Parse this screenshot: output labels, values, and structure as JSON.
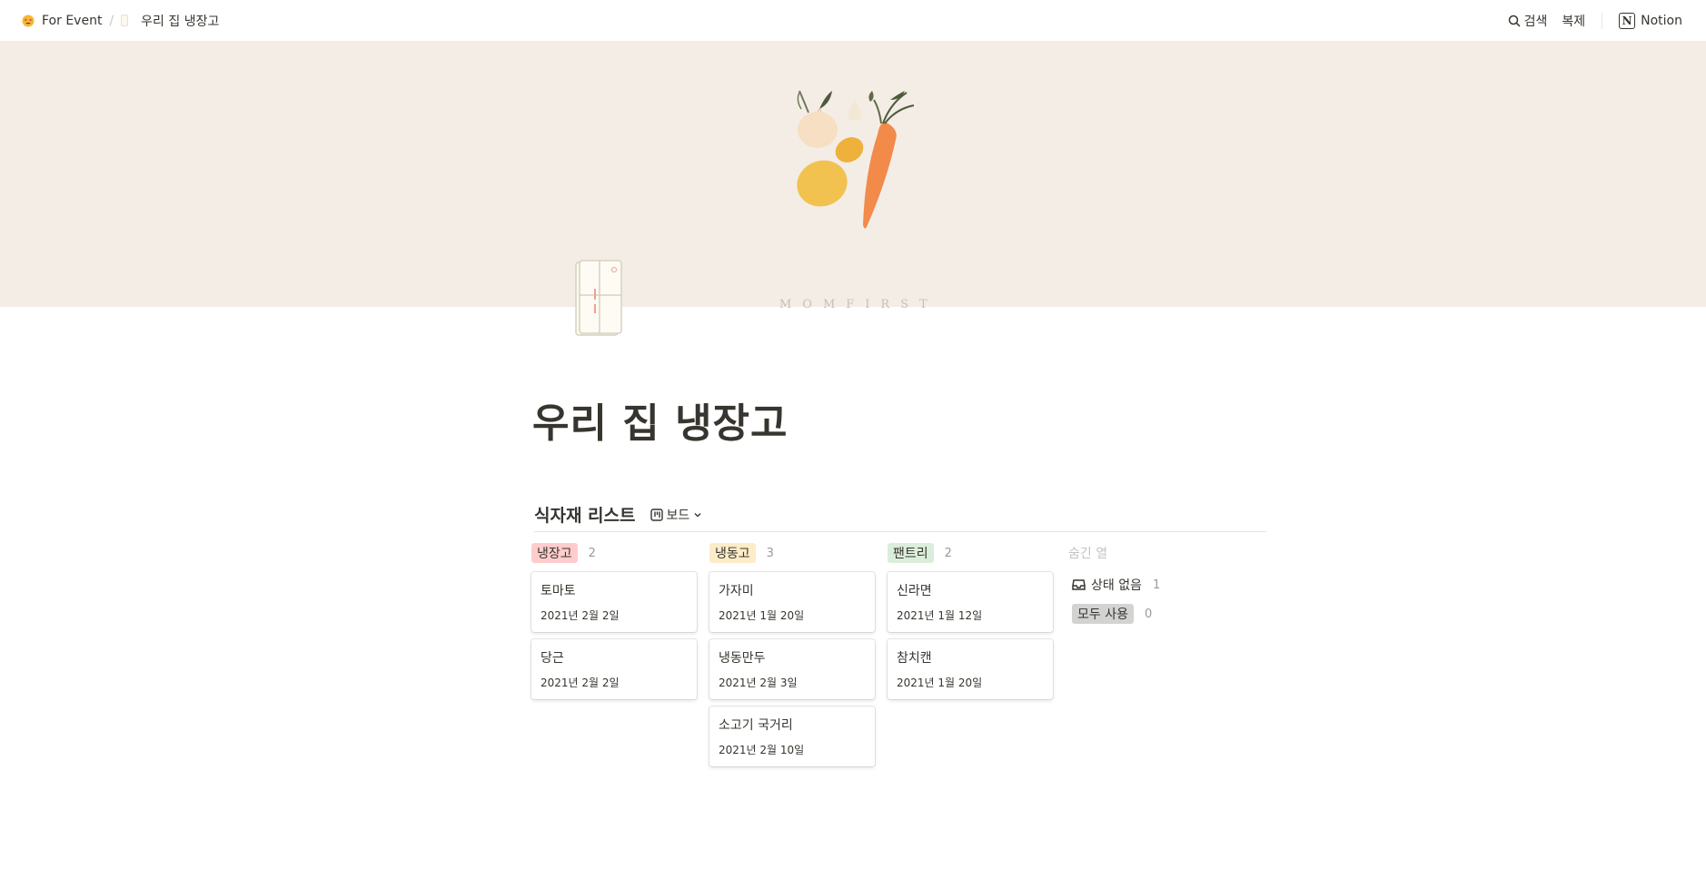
{
  "breadcrumb": {
    "workspace": "For Event",
    "separator": "/",
    "page": "우리 집 냉장고"
  },
  "topbar": {
    "search": "검색",
    "duplicate": "복제",
    "notion": "Notion"
  },
  "cover": {
    "brand": "MOMFIRST"
  },
  "page": {
    "title": "우리 집 냉장고"
  },
  "database": {
    "title": "식자재 리스트",
    "view": "보드",
    "columns": [
      {
        "label": "냉장고",
        "count": "2",
        "color": "#ffcccc",
        "cards": [
          {
            "title": "토마토",
            "date": "2021년 2월 2일"
          },
          {
            "title": "당근",
            "date": "2021년 2월 2일"
          }
        ]
      },
      {
        "label": "냉동고",
        "count": "3",
        "color": "#fdecc8",
        "cards": [
          {
            "title": "가자미",
            "date": "2021년 1월 20일"
          },
          {
            "title": "냉동만두",
            "date": "2021년 2월 3일"
          },
          {
            "title": "소고기 국거리",
            "date": "2021년 2월 10일"
          }
        ]
      },
      {
        "label": "팬트리",
        "count": "2",
        "color": "#dbeddb",
        "cards": [
          {
            "title": "신라면",
            "date": "2021년 1월 12일"
          },
          {
            "title": "참치캔",
            "date": "2021년 1월 20일"
          }
        ]
      }
    ],
    "hidden": {
      "label": "숨긴 열",
      "items": [
        {
          "label": "상태 없음",
          "count": "1"
        },
        {
          "label": "모두 사용",
          "count": "0"
        }
      ]
    }
  }
}
